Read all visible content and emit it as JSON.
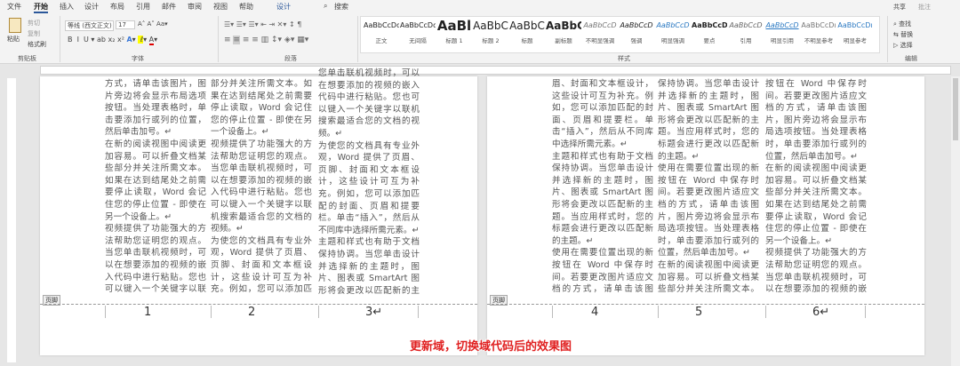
{
  "tabs": [
    "文件",
    "开始",
    "插入",
    "设计",
    "布局",
    "引用",
    "邮件",
    "审阅",
    "视图",
    "帮助",
    "设计"
  ],
  "search": "搜索",
  "share": "共享",
  "comments": "批注",
  "clipboard": {
    "paste": "粘贴",
    "cut": "剪切",
    "copy": "复制",
    "format_painter": "格式刷",
    "label": "剪贴板"
  },
  "font": {
    "name": "等线 (西文正文)",
    "size": "17",
    "label": "字体"
  },
  "paragraph": {
    "label": "段落"
  },
  "styles": {
    "label": "样式",
    "items": [
      {
        "preview": "AaBbCcDd",
        "name": "正文"
      },
      {
        "preview": "AaBbCcDd",
        "name": "无间隔"
      },
      {
        "preview": "AaBl",
        "name": "标题 1"
      },
      {
        "preview": "AaBbC",
        "name": "标题 2"
      },
      {
        "preview": "AaBbC",
        "name": "标题"
      },
      {
        "preview": "AaBbC",
        "name": "副标题"
      },
      {
        "preview": "AaBbCcD",
        "name": "不明显强调"
      },
      {
        "preview": "AaBbCcD",
        "name": "强调"
      },
      {
        "preview": "AaBbCcD",
        "name": "明显强调"
      },
      {
        "preview": "AaBbCcD",
        "name": "要点"
      },
      {
        "preview": "AaBbCcD",
        "name": "引用"
      },
      {
        "preview": "AaBbCcD",
        "name": "明显引用"
      },
      {
        "preview": "AaBbCcDı",
        "name": "不明显参考"
      },
      {
        "preview": "AaBbCcDı",
        "name": "明显参考"
      }
    ]
  },
  "editing": {
    "find": "查找",
    "replace": "替换",
    "select": "选择",
    "label": "编辑"
  },
  "footer_tag": "页脚",
  "pages": [
    {
      "columns": [
        [
          "方式，请单击该图片，图片旁边将会显示布局选项按钮。当处理表格时，单击要添加行或列的位置，然后单击加号。↵",
          "在新的阅读视图中阅读更加容易。可以折叠文档某些部分并关注所需文本。如果在达到结尾处之前需要停止读取，Word 会记住您的停止位置 - 即使在另一个设备上。↵",
          "视频提供了功能强大的方法帮助您证明您的观点。当您单击联机视频时，可以在想要添加的视频的嵌入代码中进行粘贴。您也可以键入一个关键字以联机搜索最适合您的文档的视频。↵"
        ],
        [
          "部分并关注所需文本。如果在达到结尾处之前需要停止读取，Word 会记住您的停止位置 - 即使在另一个设备上。↵",
          "视频提供了功能强大的方法帮助您证明您的观点。当您单击联机视频时，可以在想要添加的视频的嵌入代码中进行粘贴。您也可以键入一个关键字以联机搜索最适合您的文档的视频。↵",
          "为使您的文档具有专业外观，Word 提供了页眉、页脚、封面和文本框设计，这些设计可互为补充。例如，您可以添加匹配的封面、页眉和提要栏。单击“插入”，然后从不同库中选择所需"
        ],
        [
          "您单击联机视频时，可以在想要添加的视频的嵌入代码中进行粘贴。您也可以键入一个关键字以联机搜索最适合您的文档的视频。↵",
          "为使您的文档具有专业外观，Word 提供了页眉、页脚、封面和文本框设计，这些设计可互为补充。例如，您可以添加匹配的封面、页眉和提要栏。单击“插入”，然后从不同库中选择所需元素。↵",
          "主题和样式也有助于文档保持协调。当您单击设计并选择新的主题时，图片、图表或 SmartArt 图形将会更改以匹配新的主题。当应用样式时，您的标题会进行更"
        ]
      ],
      "numbers": [
        "1",
        "2",
        "3↵"
      ]
    },
    {
      "columns": [
        [
          "眉、封面和文本框设计，这些设计可互为补充。例如，您可以添加匹配的封面、页眉和提要栏。单击“插入”，然后从不同库中选择所需元素。↵",
          "主题和样式也有助于文档保持协调。当您单击设计并选择新的主题时，图片、图表或 SmartArt 图形将会更改以匹配新的主题。当应用样式时，您的标题会进行更改以匹配新的主题。↵",
          "使用在需要位置出现的新按钮在 Word 中保存时间。若要更改图片适应文档的方式，请单击该图片，图片旁边将会显示布局选项按钮。当处理表格时，单击要"
        ],
        [
          "保持协调。当您单击设计并选择新的主题时，图片、图表或 SmartArt 图形将会更改以匹配新的主题。当应用样式时，您的标题会进行更改以匹配新的主题。↵",
          "使用在需要位置出现的新按钮在 Word 中保存时间。若要更改图片适应文档的方式，请单击该图片，图片旁边将会显示布局选项按钮。当处理表格时，单击要添加行或列的位置，然后单击加号。↵",
          "在新的阅读视图中阅读更加容易。可以折叠文档某些部分并关注所需文本。如果在达到结尾处之前需要停止读取，Word 会记住您的"
        ],
        [
          "按钮在 Word 中保存时间。若要更改图片适应文档的方式，请单击该图片，图片旁边将会显示布局选项按钮。当处理表格时，单击要添加行或列的位置，然后单击加号。↵",
          "在新的阅读视图中阅读更加容易。可以折叠文档某些部分并关注所需文本。如果在达到结尾处之前需要停止读取，Word 会记住您的停止位置 - 即使在另一个设备上。↵",
          "视频提供了功能强大的方法帮助您证明您的观点。当您单击联机视频时，可以在想要添加的视频的嵌入代码中进行粘贴。您也可以键"
        ]
      ],
      "numbers": [
        "4",
        "5",
        "6↵"
      ]
    }
  ],
  "caption": "更新域，切换域代码后的效果图",
  "colors": {
    "accent": "#2b579a",
    "caption": "#e02020"
  }
}
